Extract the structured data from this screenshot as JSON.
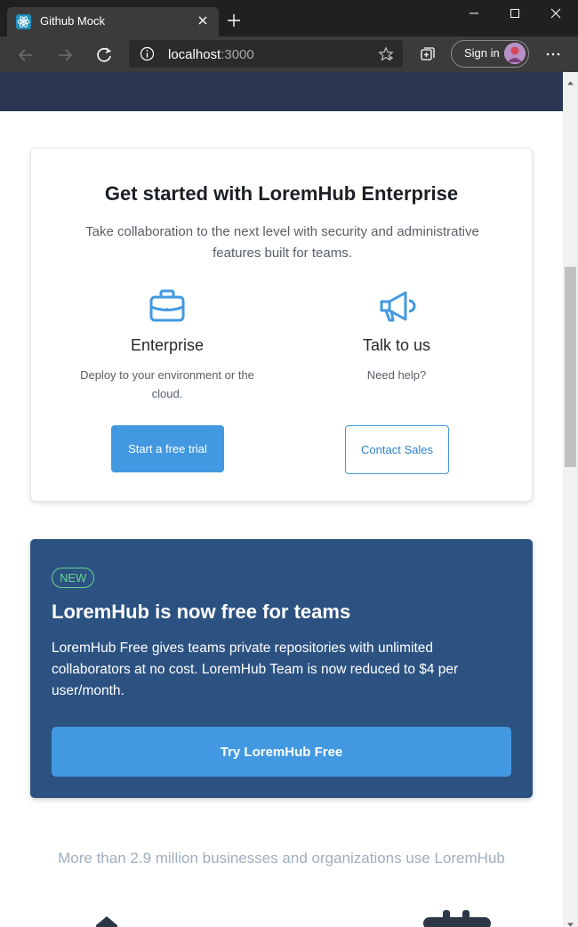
{
  "browser": {
    "tab_title": "Github Mock",
    "url_host": "localhost",
    "url_port": ":3000",
    "signin_label": "Sign in"
  },
  "enterprise": {
    "title": "Get started with LoremHub Enterprise",
    "subtitle": "Take collaboration to the next level with security and administrative features built for teams.",
    "columns": [
      {
        "icon": "briefcase-icon",
        "title": "Enterprise",
        "description": "Deploy to your environment or the cloud.",
        "button": "Start a free trial"
      },
      {
        "icon": "megaphone-icon",
        "title": "Talk to us",
        "description": "Need help?",
        "button": "Contact Sales"
      }
    ]
  },
  "free_teams": {
    "badge": "NEW",
    "title": "LoremHub is now free for teams",
    "description": "LoremHub Free gives teams private repositories with unlimited collaborators at no cost. LoremHub Team is now reduced to $4 per user/month.",
    "button": "Try LoremHub Free"
  },
  "businesses_text": "More than 2.9 million businesses and organizations use LoremHub",
  "colors": {
    "accent": "#4299e1",
    "hero_strip": "#2a3652",
    "free_card": "#2c5282",
    "badge": "#68d391",
    "muted_text": "#a0aec0"
  }
}
